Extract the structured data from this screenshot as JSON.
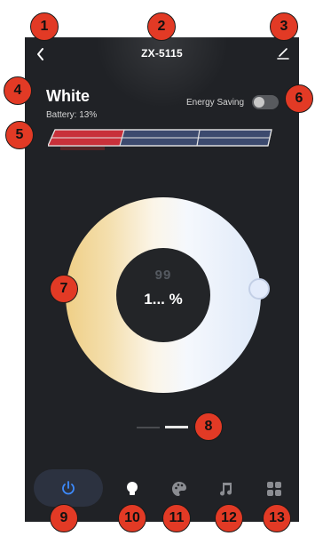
{
  "header": {
    "title": "ZX-5115"
  },
  "device": {
    "mode_name": "White",
    "battery": "Battery: 13%",
    "energy_saving_label": "Energy Saving",
    "energy_saving_on": false
  },
  "dial": {
    "ghost_value": "99",
    "brightness_value": "1... %"
  },
  "pager": {
    "current_page": 2,
    "total_pages": 2
  },
  "bottom_nav": {
    "items": [
      {
        "name": "power",
        "icon": "power-icon",
        "active": true
      },
      {
        "name": "bulb",
        "icon": "bulb-icon"
      },
      {
        "name": "palette",
        "icon": "palette-icon"
      },
      {
        "name": "music",
        "icon": "music-icon"
      },
      {
        "name": "grid",
        "icon": "grid-icon"
      }
    ]
  },
  "markers": [
    "1",
    "2",
    "3",
    "4",
    "5",
    "6",
    "7",
    "8",
    "9",
    "10",
    "11",
    "12",
    "13"
  ],
  "colors": {
    "background": "#202226",
    "accent_power": "#3d8bff",
    "marker": "#e23a25"
  }
}
